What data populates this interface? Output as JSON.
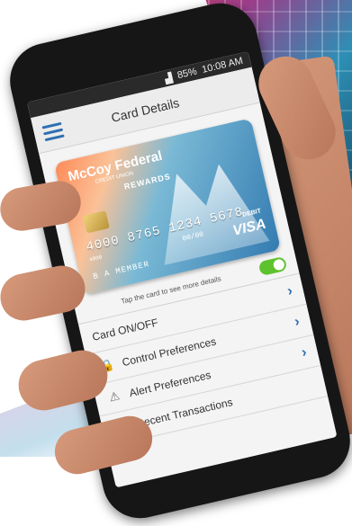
{
  "status_bar": {
    "signal": "▟",
    "battery": "85%",
    "time": "10:08 AM"
  },
  "header": {
    "title": "Card Details"
  },
  "card": {
    "brand": "McCoy Federal",
    "brand_sub": "CREDIT UNION",
    "program": "REWARDS",
    "number": "4000 8765 1234 5678",
    "number_small": "4000",
    "expiry": "00/00",
    "holder": "B A MEMBER",
    "type": "DEBIT",
    "network": "VISA"
  },
  "card_hint": "Tap the card to see more details",
  "toggle": {
    "on": true
  },
  "menu": [
    {
      "label": "Card ON/OFF",
      "icon": ""
    },
    {
      "label": "Control Preferences",
      "icon": "lock-icon"
    },
    {
      "label": "Alert Preferences",
      "icon": "warning-icon"
    },
    {
      "label": "Recent Transactions",
      "icon": "receipt-icon"
    }
  ],
  "colors": {
    "accent": "#2f6fb3",
    "toggle_on": "#5ec22d"
  }
}
